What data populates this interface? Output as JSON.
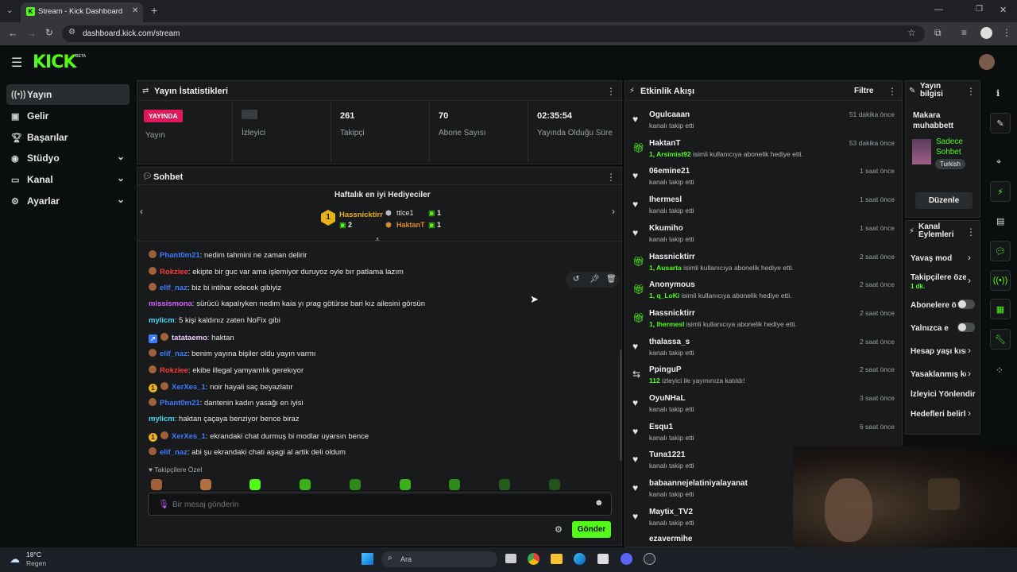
{
  "browser": {
    "tab_title": "Stream - Kick Dashboard",
    "url": "dashboard.kick.com/stream"
  },
  "header": {
    "logo": "KICK",
    "logo_badge": "BETA"
  },
  "sidebar": {
    "items": [
      {
        "label": "Yayın",
        "icon": "broadcast-icon"
      },
      {
        "label": "Gelir",
        "icon": "revenue-icon"
      },
      {
        "label": "Başarılar",
        "icon": "trophy-icon"
      },
      {
        "label": "Stüdyo",
        "icon": "studio-icon"
      },
      {
        "label": "Kanal",
        "icon": "channel-icon"
      },
      {
        "label": "Ayarlar",
        "icon": "gear-icon"
      }
    ]
  },
  "stats": {
    "title": "Yayın İstatistikleri",
    "status_badge": "YAYINDA",
    "status_label": "Yayın",
    "viewers_label": "İzleyici",
    "followers_value": "261",
    "followers_label": "Takipçi",
    "subs_value": "70",
    "subs_label": "Abone Sayısı",
    "uptime_value": "02:35:54",
    "uptime_label": "Yayında Olduğu Süre"
  },
  "chat": {
    "title": "Sohbet",
    "gifters_title": "Haftalık en iyi Hediyeciler",
    "top_gifter": {
      "rank": "1",
      "name": "Hassnicktirr",
      "count": "2"
    },
    "gifter_2": {
      "name": "ttlce1",
      "count": "1"
    },
    "gifter_3": {
      "name": "HaktanT",
      "count": "1"
    },
    "messages": [
      {
        "user": "Phant0m21",
        "color": "#3d7bff",
        "text": "nedim tahmini ne zaman delirir"
      },
      {
        "user": "Rokziee",
        "color": "#ff3b3b",
        "text": "ekipte bir guc var ama işlemiyor duruyoz oyle bır patlama lazım"
      },
      {
        "user": "elif_naz",
        "color": "#3d7bff",
        "text": "biz bi intihar edecek gibiyiz"
      },
      {
        "user": "missismona",
        "color": "#d55cff",
        "text": "sürücü kapalıyken nedim kaia yı prag götürse bari kız ailesini görsün"
      },
      {
        "user": "mylicm",
        "color": "#4ad9f5",
        "text": "5 kişi kaldınız zaten NoFix gibi"
      },
      {
        "user": "tatataemo",
        "color": "#f0c7ff",
        "text": "haktan"
      },
      {
        "user": "elif_naz",
        "color": "#3d7bff",
        "text": "benim yayına bişiler oldu yayın varmı"
      },
      {
        "user": "Rokziee",
        "color": "#ff3b3b",
        "text": "ekibe illegal yamyamlık gerekıyor"
      },
      {
        "user": "XerXes_1",
        "color": "#3d7bff",
        "text": "noir hayali saç beyazlatır"
      },
      {
        "user": "Phant0m21",
        "color": "#3d7bff",
        "text": "dantenin kadın yasağı en iyisi"
      },
      {
        "user": "mylicm",
        "color": "#4ad9f5",
        "text": "haktan çaçaya benziyor bence biraz"
      },
      {
        "user": "XerXes_1",
        "color": "#3d7bff",
        "text": "ekrandaki chat durmuş bi modlar uyarsın bence"
      },
      {
        "user": "elif_naz",
        "color": "#3d7bff",
        "text": "abi şu ekrandaki chati aşagi al artik deli oldum"
      }
    ],
    "emote_section": "Takipçilere Özel",
    "input_placeholder": "Bir mesaj gönderin",
    "send_label": "Gönder"
  },
  "events": {
    "title": "Etkinlik Akışı",
    "filter_label": "Filtre",
    "items": [
      {
        "type": "follow",
        "name": "Ogulcaaan",
        "prefix": "",
        "desc": "kanalı takip etti",
        "time": "51 dakika önce"
      },
      {
        "type": "gift",
        "name": "HaktanT",
        "prefix": "1, Arsimist92",
        "desc": "isimli kullanıcıya abonelik hediye etti.",
        "time": "53 dakika önce"
      },
      {
        "type": "follow",
        "name": "06emine21",
        "prefix": "",
        "desc": "kanalı takip etti",
        "time": "1 saat önce"
      },
      {
        "type": "follow",
        "name": "Ihermesl",
        "prefix": "",
        "desc": "kanalı takip etti",
        "time": "1 saat önce"
      },
      {
        "type": "follow",
        "name": "Kkumiho",
        "prefix": "",
        "desc": "kanalı takip etti",
        "time": "1 saat önce"
      },
      {
        "type": "gift",
        "name": "Hassnicktirr",
        "prefix": "1, Ausarta",
        "desc": "isimli kullanıcıya abonelik hediye etti.",
        "time": "2 saat önce"
      },
      {
        "type": "gift",
        "name": "Anonymous",
        "prefix": "1, q_LoKi",
        "desc": "isimli kullanıcıya abonelik hediye etti.",
        "time": "2 saat önce"
      },
      {
        "type": "gift",
        "name": "Hassnicktirr",
        "prefix": "1, Ihermesl",
        "desc": "isimli kullanıcıya abonelik hediye etti.",
        "time": "2 saat önce"
      },
      {
        "type": "follow",
        "name": "thalassa_s",
        "prefix": "",
        "desc": "kanalı takip etti",
        "time": "2 saat önce"
      },
      {
        "type": "host",
        "name": "PpinguP",
        "prefix": "112",
        "desc": "izleyici ile yayınınıza katıldı!",
        "time": "2 saat önce"
      },
      {
        "type": "follow",
        "name": "OyuNHaL",
        "prefix": "",
        "desc": "kanalı takip etti",
        "time": "3 saat önce"
      },
      {
        "type": "follow",
        "name": "Esqu1",
        "prefix": "",
        "desc": "kanalı takip etti",
        "time": "6 saat önce"
      },
      {
        "type": "follow",
        "name": "Tuna1221",
        "prefix": "",
        "desc": "kanalı takip etti",
        "time": ""
      },
      {
        "type": "follow",
        "name": "babaannejelatiniyalayanat",
        "prefix": "",
        "desc": "kanalı takip etti",
        "time": ""
      },
      {
        "type": "follow",
        "name": "Maytix_TV2",
        "prefix": "",
        "desc": "kanalı takip etti",
        "time": ""
      }
    ]
  },
  "stream_info": {
    "title": "Yayın bilgisi",
    "stream_title": "Makara muhabbett",
    "category": "Sadece Sohbet",
    "language": "Turkish",
    "edit_label": "Düzenle"
  },
  "channel_actions": {
    "title": "Kanal Eylemleri",
    "items": [
      {
        "label": "Yavaş mod",
        "kind": "chevron",
        "sub": ""
      },
      {
        "label": "Takipçilere özel",
        "kind": "chevron",
        "sub": "1 dk."
      },
      {
        "label": "Abonelere özel",
        "kind": "toggle",
        "sub": ""
      },
      {
        "label": "Yalnızca emote",
        "kind": "toggle",
        "sub": ""
      },
      {
        "label": "Hesap yaşı kısıtlaması",
        "kind": "chevron",
        "sub": ""
      },
      {
        "label": "Yasaklanmış kelimeler",
        "kind": "chevron",
        "sub": ""
      },
      {
        "label": "İzleyici Yönlendir",
        "kind": "none",
        "sub": ""
      },
      {
        "label": "Hedefleri belirle",
        "kind": "chevron",
        "sub": ""
      }
    ]
  },
  "taskbar": {
    "temperature": "18°C",
    "weather": "Regen",
    "search": "Ara"
  },
  "colors": {
    "accent": "#53fc18",
    "live": "#e0185a"
  }
}
